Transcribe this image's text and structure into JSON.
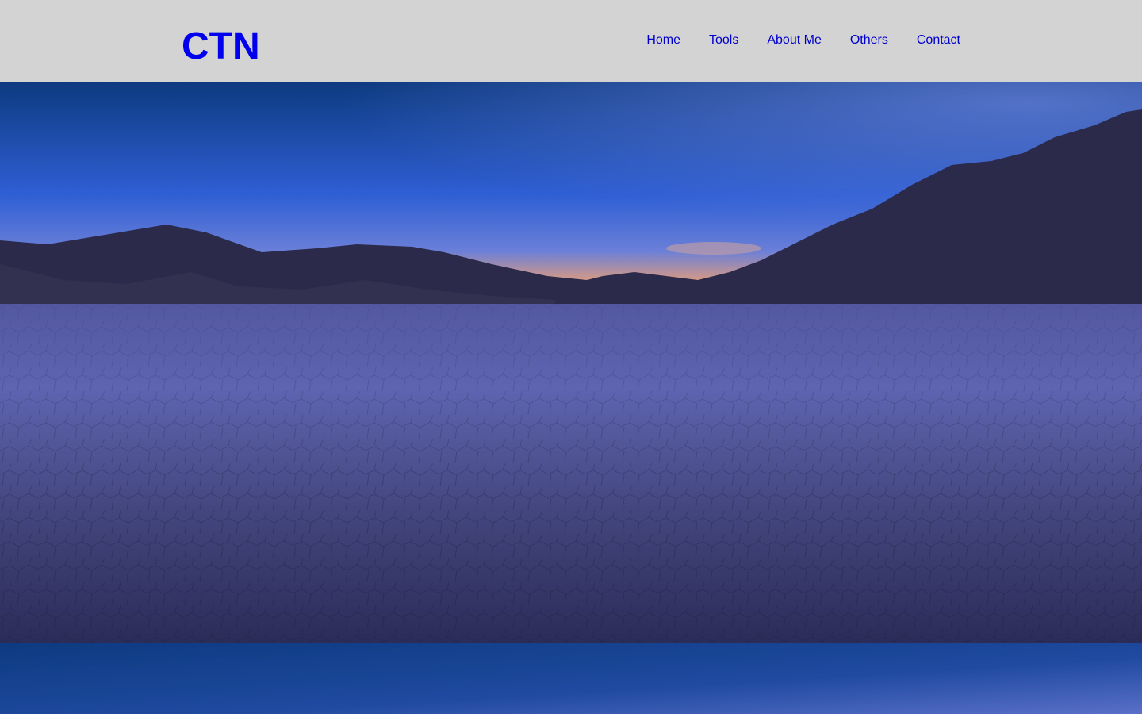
{
  "site": {
    "logo_text": "CTN"
  },
  "nav": {
    "items": [
      {
        "label": "Home"
      },
      {
        "label": "Tools"
      },
      {
        "label": "About Me"
      },
      {
        "label": "Others"
      },
      {
        "label": "Contact"
      }
    ]
  },
  "hero": {
    "image_subject": "desert playa with mountains at dusk",
    "colors": {
      "sky_top": "#0d3a80",
      "sky_mid": "#2f5fd4",
      "horizon_glow": "#f0a070",
      "mountains": "#2c2a4a",
      "playa": "#4a4c8c",
      "playa_dark": "#2e2f5e"
    }
  },
  "colors": {
    "header_bg": "#d3d3d3",
    "logo": "#0000ee",
    "nav_link": "#0000cc"
  }
}
